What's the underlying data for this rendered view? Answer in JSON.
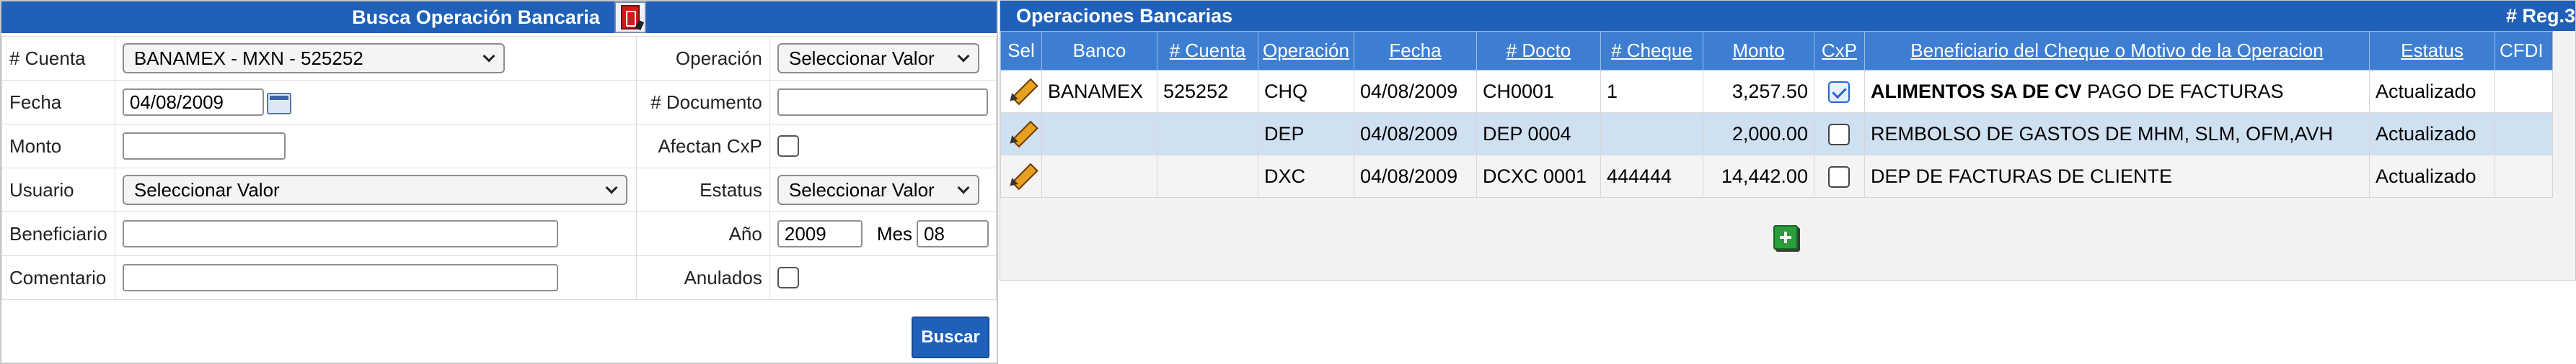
{
  "search": {
    "title": "Busca Operación Bancaria",
    "fields": {
      "cuenta_label": "# Cuenta",
      "cuenta_value": "BANAMEX - MXN - 525252",
      "fecha_label": "Fecha",
      "fecha_value": "04/08/2009",
      "monto_label": "Monto",
      "monto_value": "",
      "usuario_label": "Usuario",
      "usuario_value": "Seleccionar Valor",
      "beneficiario_label": "Beneficiario",
      "beneficiario_value": "",
      "comentario_label": "Comentario",
      "comentario_value": "",
      "operacion_label": "Operación",
      "operacion_value": "Seleccionar Valor",
      "documento_label": "# Documento",
      "documento_value": "",
      "afectan_label": "Afectan CxP",
      "estatus_label": "Estatus",
      "estatus_value": "Seleccionar Valor",
      "anio_label": "Año",
      "anio_value": "2009",
      "mes_label": "Mes",
      "mes_value": "08",
      "anulados_label": "Anulados"
    },
    "buscar_label": "Buscar"
  },
  "results": {
    "title": "Operaciones Bancarias",
    "reg_label": "# Reg.3",
    "columns": [
      "Sel",
      "Banco",
      "# Cuenta",
      "Operación",
      "Fecha",
      "# Docto",
      "# Cheque",
      "Monto",
      "CxP",
      "Beneficiario del Cheque o Motivo de la Operacion",
      "Estatus",
      "CFDI"
    ],
    "rows": [
      {
        "banco": "BANAMEX",
        "cuenta": "525252",
        "operacion": "CHQ",
        "fecha": "04/08/2009",
        "docto": "CH0001",
        "cheque": "1",
        "monto": "3,257.50",
        "cxp": true,
        "beneficiario_bold": "ALIMENTOS SA DE CV",
        "beneficiario": "PAGO DE FACTURAS",
        "estatus": "Actualizado",
        "cfdi": ""
      },
      {
        "banco": "",
        "cuenta": "",
        "operacion": "DEP",
        "fecha": "04/08/2009",
        "docto": "DEP 0004",
        "cheque": "",
        "monto": "2,000.00",
        "cxp": false,
        "beneficiario_bold": "",
        "beneficiario": "REMBOLSO DE GASTOS DE MHM, SLM, OFM,AVH",
        "estatus": "Actualizado",
        "cfdi": ""
      },
      {
        "banco": "",
        "cuenta": "",
        "operacion": "DXC",
        "fecha": "04/08/2009",
        "docto": "DCXC 0001",
        "cheque": "444444",
        "monto": "14,442.00",
        "cxp": false,
        "beneficiario_bold": "",
        "beneficiario": "DEP DE FACTURAS DE CLIENTE",
        "estatus": "Actualizado",
        "cfdi": ""
      }
    ]
  },
  "icons": {
    "header": "bank-book-icon",
    "calendar": "calendar-icon",
    "edit": "pencil-icon",
    "add": "add-icon"
  },
  "colors": {
    "header_blue": "#1f60b8",
    "column_header_blue": "#3d7ed3",
    "selected_row": "#cfe0f1"
  }
}
